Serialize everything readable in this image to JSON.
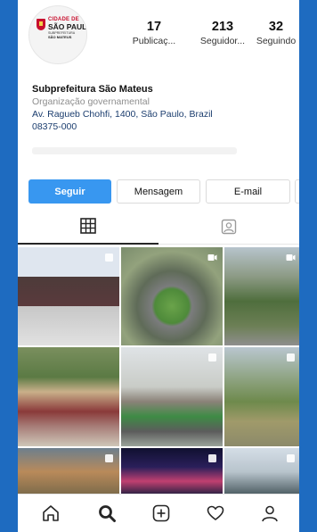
{
  "profile": {
    "logo": {
      "line1": "CIDADE DE",
      "line2": "SÃO PAULO",
      "line3": "SUBPREFEITURA",
      "line4": "SÃO MATEUS"
    },
    "stats": [
      {
        "value": "17",
        "label": "Publicaç..."
      },
      {
        "value": "213",
        "label": "Seguidor..."
      },
      {
        "value": "32",
        "label": "Seguindo"
      }
    ],
    "name": "Subprefeitura São Mateus",
    "category": "Organização governamental",
    "address_line1": "Av. Ragueb Chohfi, 1400, São Paulo, Brazil",
    "address_line2": "08375-000"
  },
  "actions": {
    "follow": "Seguir",
    "message": "Mensagem",
    "email": "E-mail",
    "more": "▾"
  },
  "tabs": [
    {
      "icon": "grid-icon",
      "active": true
    },
    {
      "icon": "tagged-person-icon",
      "active": false
    }
  ],
  "posts": [
    {
      "icon": "multiple-photos-icon"
    },
    {
      "icon": "video-icon"
    },
    {
      "icon": "video-icon"
    },
    {
      "icon": ""
    },
    {
      "icon": "multiple-photos-icon"
    },
    {
      "icon": "multiple-photos-icon"
    },
    {
      "icon": "multiple-photos-icon"
    },
    {
      "icon": "multiple-photos-icon"
    },
    {
      "icon": "multiple-photos-icon"
    }
  ],
  "bottom_nav": [
    "home-icon",
    "search-icon",
    "new-post-icon",
    "activity-heart-icon",
    "profile-icon"
  ],
  "colors": {
    "follow_button": "#3897f0",
    "background_blue": "#1a5fa8",
    "address_link": "#1b3d6e"
  }
}
